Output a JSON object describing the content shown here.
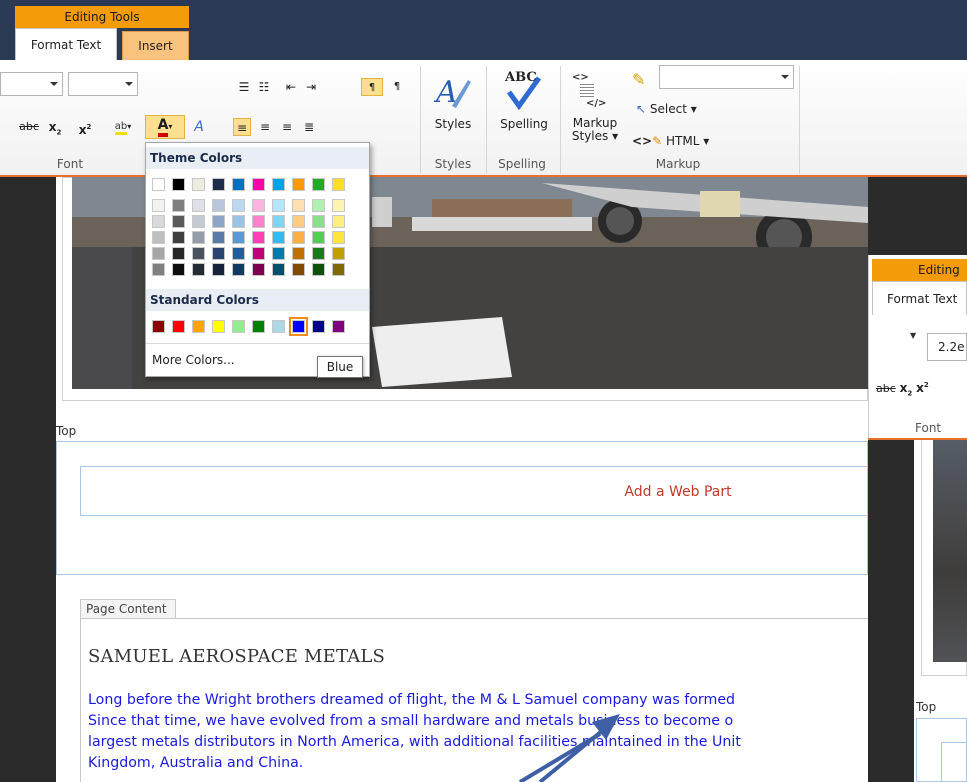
{
  "ribbon": {
    "context_group": "Editing Tools",
    "tabs": [
      {
        "label": "Format Text",
        "selected": true
      },
      {
        "label": "Insert",
        "selected": false
      }
    ],
    "groups": {
      "font": "Font",
      "styles": "Styles",
      "spelling": "Spelling",
      "markup": "Markup"
    },
    "buttons": {
      "styles": "Styles",
      "spelling": "Spelling",
      "spelling_glyph": "ABC",
      "markup_styles_1": "Markup",
      "markup_styles_2": "Styles",
      "select": "Select",
      "html": "HTML",
      "strike": "abc",
      "subscript": "x",
      "subscript_mark": "2",
      "superscript": "x",
      "superscript_mark": "2",
      "highlight_glyph": "ab",
      "font_color_glyph": "A",
      "clear_format_glyph": "A",
      "markup_glyph_top": "<>",
      "markup_glyph_bottom": "</>",
      "html_glyph": "<>",
      "pilcrow_ltr": "¶",
      "pilcrow_rtl": "¶"
    }
  },
  "color_picker": {
    "theme_header": "Theme Colors",
    "standard_header": "Standard Colors",
    "more_colors": "More Colors...",
    "tooltip": "Blue",
    "theme_top_row": [
      "#ffffff",
      "#000000",
      "#eeece1",
      "#1f2d4a",
      "#0070c0",
      "#ff00a8",
      "#00a2e8",
      "#ff9900",
      "#22aa22",
      "#ffdd22"
    ],
    "theme_shades": [
      [
        "#f2f2f2",
        "#7f7f7f",
        "#dde1e6",
        "#b8c7dc",
        "#bdd7ee",
        "#ffb3e0",
        "#b3e5fb",
        "#ffe0b3",
        "#b3eeb3",
        "#fff5b3"
      ],
      [
        "#d9d9d9",
        "#595959",
        "#c4cad2",
        "#8da6c8",
        "#9cc3e6",
        "#ff80cc",
        "#80d4f7",
        "#ffcc80",
        "#88e088",
        "#ffee80"
      ],
      [
        "#bfbfbf",
        "#3f3f3f",
        "#939ca8",
        "#5a7aa8",
        "#5b9bd5",
        "#ff3fb4",
        "#33bbf0",
        "#ffb040",
        "#55cc55",
        "#ffe540"
      ],
      [
        "#a6a6a6",
        "#262626",
        "#4a5260",
        "#2a4470",
        "#1f5e9a",
        "#c00078",
        "#007aa8",
        "#c07000",
        "#187a18",
        "#c0a000"
      ],
      [
        "#808080",
        "#0d0d0d",
        "#262b33",
        "#15223a",
        "#103a60",
        "#800050",
        "#005070",
        "#804a00",
        "#0e500e",
        "#806a00"
      ]
    ],
    "standard": [
      "#8b0000",
      "#ff0000",
      "#ffa500",
      "#ffff00",
      "#90ee90",
      "#008000",
      "#add8e6",
      "#0000ff",
      "#00008b",
      "#800080"
    ],
    "selected_standard": "#0000ff"
  },
  "page": {
    "zone_label": "Top",
    "add_web_part": "Add a Web Part",
    "content_tab": "Page Content",
    "title": "SAMUEL AEROSPACE METALS",
    "paragraph_lines": [
      "Long before the Wright brothers dreamed of flight, the M & L Samuel company was formed",
      "Since that time, we have evolved from a small hardware and metals business to become o",
      "largest metals distributors in North America, with additional facilities maintained in the Unit",
      "Kingdom, Australia and China."
    ]
  },
  "right_overlay": {
    "context_group": "Editing",
    "tab": "Format Text",
    "font_size": "2.2e",
    "font_group": "Font",
    "zone_label": "Top",
    "tools": {
      "strike": "abc",
      "sub": "x",
      "sub_mark": "2",
      "sup": "x",
      "sup_mark": "2"
    }
  },
  "colors": {
    "ribbon_dark": "#2a3a54",
    "context_orange": "#f49b0a",
    "accent_orange": "#e8702a",
    "link_blue": "#1a1adf",
    "add_web_part_red": "#c0392b"
  }
}
